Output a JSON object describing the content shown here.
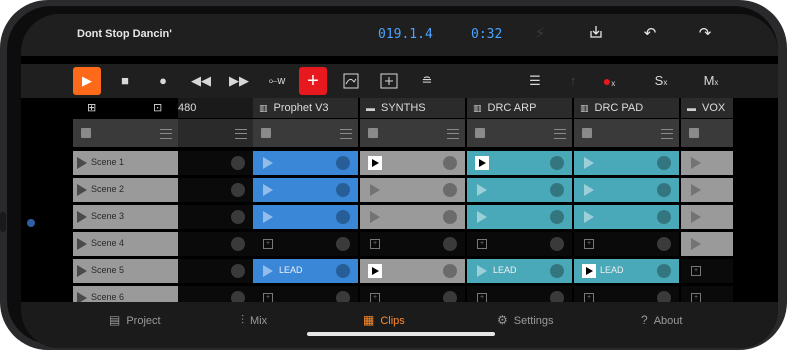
{
  "header": {
    "song_title": "Dont Stop Dancin'",
    "position": "019.1.4",
    "time": "0:32"
  },
  "toolbar": {
    "icons": [
      "play-icon",
      "stop-icon",
      "record-icon",
      "rewind-icon",
      "fast-forward-icon",
      "automation-icon",
      "add-track-icon",
      "automation-curve-icon",
      "grid-add-icon",
      "stack-icon",
      "mixer-sliders-icon",
      "arrow-up-icon",
      "clear-record-icon",
      "clear-solo-icon",
      "clear-mute-icon"
    ],
    "solo_label": "S",
    "mute_label": "M",
    "x_label": "x"
  },
  "grid": {
    "partial_column_label": "480",
    "columns": [
      {
        "name": "Prophet V3",
        "icon": "keyboard-icon"
      },
      {
        "name": "SYNTHS",
        "icon": "folder-icon"
      },
      {
        "name": "DRC ARP",
        "icon": "keyboard-icon"
      },
      {
        "name": "DRC PAD",
        "icon": "keyboard-icon"
      },
      {
        "name": "VOX",
        "icon": "folder-icon"
      }
    ],
    "scenes": [
      "Scene 1",
      "Scene 2",
      "Scene 3",
      "Scene 4",
      "Scene 5",
      "Scene 6"
    ],
    "clip_label": "LEAD"
  },
  "tabs": [
    {
      "label": "Project",
      "icon": "project-icon"
    },
    {
      "label": "Mix",
      "icon": "mixer-icon"
    },
    {
      "label": "Clips",
      "icon": "clips-grid-icon",
      "active": true
    },
    {
      "label": "Settings",
      "icon": "settings-icon"
    },
    {
      "label": "About",
      "icon": "help-icon"
    }
  ],
  "colors": {
    "accent_orange": "#ff6a1a",
    "record_red": "#e8181f",
    "time_blue": "#4aa3ff",
    "clip_blue": "#3a87d8",
    "clip_teal": "#4aa9b8"
  }
}
